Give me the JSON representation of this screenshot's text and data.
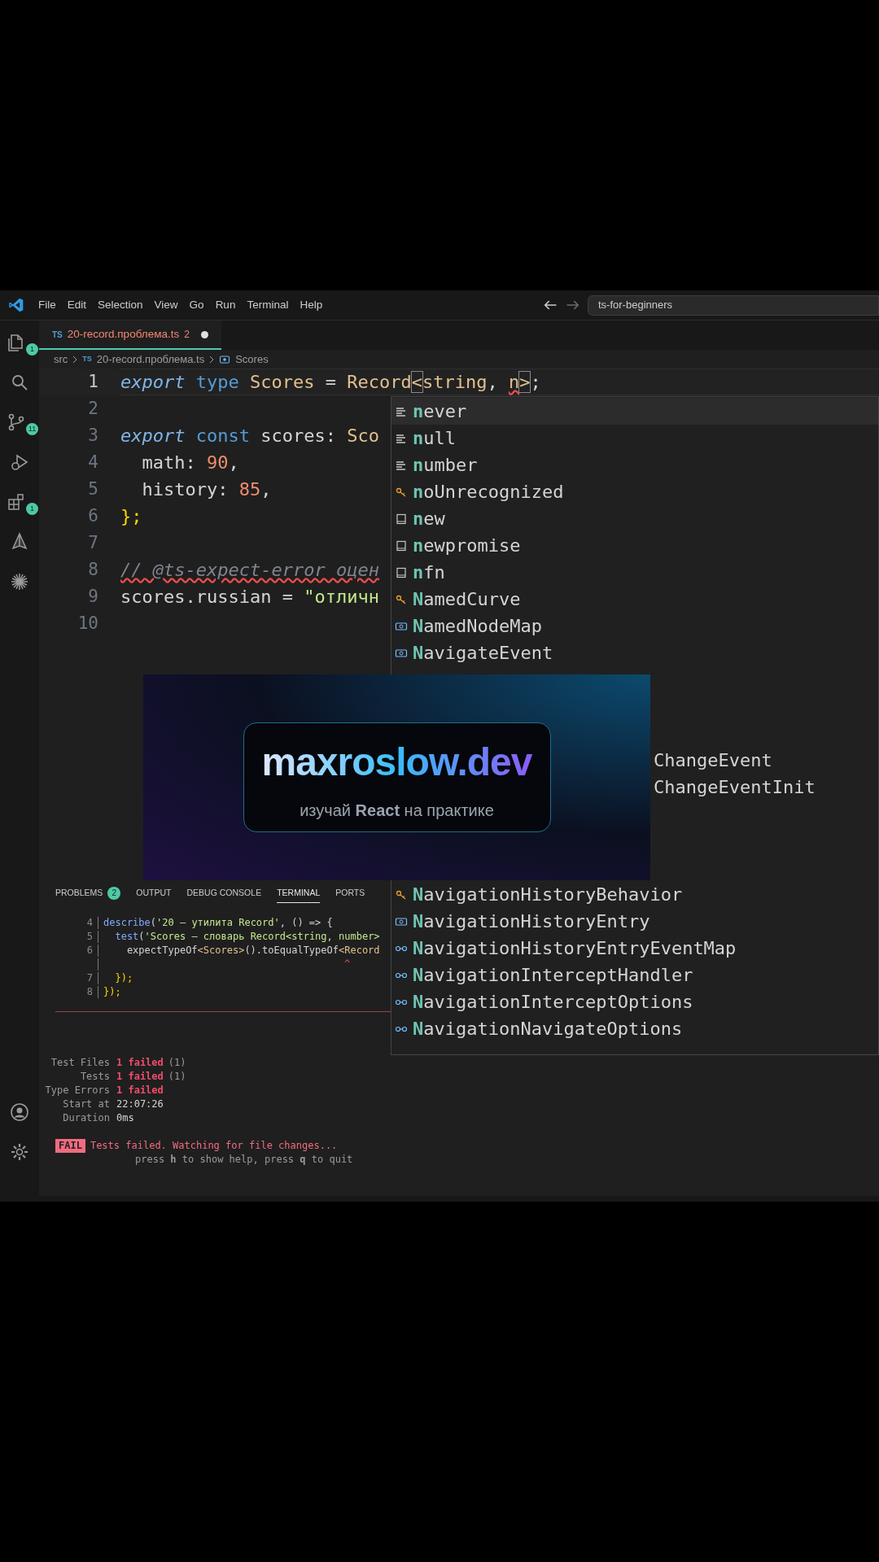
{
  "title_bar": {
    "menus": [
      "File",
      "Edit",
      "Selection",
      "View",
      "Go",
      "Run",
      "Terminal",
      "Help"
    ],
    "search": {
      "value": "ts-for-beginners"
    }
  },
  "activity_bar": {
    "top": [
      {
        "kind": "files",
        "badge": "1"
      },
      {
        "kind": "search"
      },
      {
        "kind": "source-control",
        "badge": "11"
      },
      {
        "kind": "run"
      },
      {
        "kind": "extensions",
        "badge": "1"
      },
      {
        "kind": "triangle"
      },
      {
        "kind": "asterisk"
      }
    ],
    "bottom": [
      {
        "kind": "account"
      },
      {
        "kind": "manage"
      }
    ]
  },
  "tab": {
    "icon": "TS",
    "label": "20-record.проблема.ts",
    "problems": "2",
    "dirty": true,
    "selected": true
  },
  "breadcrumb": [
    {
      "label": "src"
    },
    {
      "icon": "TS",
      "label": "20-record.проблема.ts"
    },
    {
      "label": "Scores"
    }
  ],
  "editor": {
    "lines": [
      {
        "number": "1",
        "current": true,
        "tokens": [
          {
            "text": "export ",
            "kind": "kw_italic"
          },
          {
            "text": "type",
            "kind": "keyword"
          },
          {
            "text": " Scores",
            "kind": "type"
          },
          {
            "text": " = ",
            "kind": "plain"
          },
          {
            "text": "Record",
            "kind": "type"
          },
          {
            "text": "<",
            "kind": "bracket"
          },
          {
            "text": "string",
            "kind": "type"
          },
          {
            "text": ", ",
            "kind": "plain"
          },
          {
            "text": "n",
            "kind": "error"
          },
          {
            "text": ">",
            "kind": "bracket"
          },
          {
            "text": ";",
            "kind": "plain"
          }
        ]
      },
      {
        "number": "2",
        "current": false
      },
      {
        "number": "3",
        "current": false,
        "tokens": [
          {
            "text": "export ",
            "kind": "kw_italic"
          },
          {
            "text": "const",
            "kind": "keyword"
          },
          {
            "text": " scores: ",
            "kind": "plain"
          },
          {
            "text": "Sco",
            "kind": "type"
          }
        ]
      },
      {
        "number": "4",
        "current": false,
        "tokens": [
          {
            "text": "  math: ",
            "kind": "plain"
          },
          {
            "text": "90",
            "kind": "number"
          },
          {
            "text": ",",
            "kind": "plain"
          }
        ]
      },
      {
        "number": "5",
        "current": false,
        "tokens": [
          {
            "text": "  history: ",
            "kind": "plain"
          },
          {
            "text": "85",
            "kind": "number"
          },
          {
            "text": ",",
            "kind": "plain"
          }
        ]
      },
      {
        "number": "6",
        "current": false,
        "tokens": [
          {
            "text": "};",
            "kind": "brace"
          }
        ]
      },
      {
        "number": "7",
        "current": false
      },
      {
        "number": "8",
        "current": false,
        "tokens": [
          {
            "text": "// @ts-expect-error оцен",
            "kind": "comment"
          }
        ]
      },
      {
        "number": "9",
        "current": false,
        "tokens": [
          {
            "text": "scores.russian = ",
            "kind": "plain"
          },
          {
            "text": "\"отличн",
            "kind": "string"
          }
        ]
      },
      {
        "number": "10",
        "current": false
      }
    ]
  },
  "suggest_widget": {
    "groups": [
      {
        "items": [
          {
            "label": "never",
            "kind": "keyword",
            "selected": true
          },
          {
            "label": "null",
            "kind": "keyword",
            "selected": false
          },
          {
            "label": "number",
            "kind": "keyword",
            "selected": false
          },
          {
            "label": "noUnrecognized",
            "kind": "variable",
            "selected": false
          },
          {
            "label": "new",
            "kind": "snippet",
            "selected": false
          },
          {
            "label": "newpromise",
            "kind": "snippet",
            "selected": false
          },
          {
            "label": "nfn",
            "kind": "snippet",
            "selected": false
          },
          {
            "label": "NamedCurve",
            "kind": "variable",
            "selected": false
          },
          {
            "label": "NamedNodeMap",
            "kind": "class",
            "selected": false
          },
          {
            "label": "NavigateEvent",
            "kind": "class",
            "selected": false
          }
        ]
      },
      {
        "items": [
          {
            "label": "ChangeEvent",
            "kind": "clipped",
            "selected": false
          },
          {
            "label": "ChangeEventInit",
            "kind": "clipped",
            "selected": false
          }
        ]
      },
      {
        "items": [
          {
            "label": "NavigationHistoryBehavior",
            "kind": "variable",
            "selected": false
          },
          {
            "label": "NavigationHistoryEntry",
            "kind": "class",
            "selected": false
          },
          {
            "label": "NavigationHistoryEntryEventMap",
            "kind": "interface",
            "selected": false
          },
          {
            "label": "NavigationInterceptHandler",
            "kind": "interface",
            "selected": false
          },
          {
            "label": "NavigationInterceptOptions",
            "kind": "interface",
            "selected": false
          },
          {
            "label": "NavigationNavigateOptions",
            "kind": "interface",
            "selected": false
          }
        ]
      }
    ]
  },
  "promo_banner": {
    "title": "maxroslow.dev",
    "subtitle": "изучай **React** на практике"
  },
  "panel": {
    "tabs": [
      {
        "label": "PROBLEMS",
        "badge": "2",
        "selected": false
      },
      {
        "label": "OUTPUT",
        "selected": false
      },
      {
        "label": "DEBUG CONSOLE",
        "selected": false
      },
      {
        "label": "TERMINAL",
        "selected": true
      },
      {
        "label": "PORTS",
        "selected": false
      }
    ],
    "code": [
      {
        "number": "4",
        "tokens": [
          {
            "text": "describe",
            "kind": "fn"
          },
          {
            "text": "(",
            "kind": "plain"
          },
          {
            "text": "'20 — утилита Record'",
            "kind": "string"
          },
          {
            "text": ", () => {",
            "kind": "plain"
          }
        ]
      },
      {
        "number": "5",
        "tokens": [
          {
            "text": "  test",
            "kind": "fn"
          },
          {
            "text": "(",
            "kind": "plain"
          },
          {
            "text": "'Scores — словарь Record<string, number>",
            "kind": "string"
          }
        ]
      },
      {
        "number": "6",
        "tokens": [
          {
            "text": "    expectTypeOf",
            "kind": "plain"
          },
          {
            "text": "<Scores>",
            "kind": "type"
          },
          {
            "text": "().toEqualTypeOf",
            "kind": "plain"
          },
          {
            "text": "<Record",
            "kind": "type"
          }
        ]
      },
      {
        "caret": "^"
      },
      {
        "number": "7",
        "tokens": [
          {
            "text": "  });",
            "kind": "brace"
          }
        ]
      },
      {
        "number": "8",
        "tokens": [
          {
            "text": "});",
            "kind": "brace"
          }
        ]
      }
    ],
    "summary": [
      {
        "label": "Test Files",
        "value": "1 failed",
        "extra": "(1)",
        "failed": true
      },
      {
        "label": "Tests",
        "value": "1 failed",
        "extra": "(1)",
        "failed": true
      },
      {
        "label": "Type Errors",
        "value": "1 failed",
        "failed": true
      },
      {
        "label": "Start at",
        "value": "22:07:26",
        "failed": false
      },
      {
        "label": "Duration",
        "value": "0ms",
        "failed": false
      }
    ],
    "fail_badge": "FAIL",
    "fail_message": "Tests failed. Watching for file changes...",
    "hint": "press **h** to show help, press **q** to quit"
  }
}
